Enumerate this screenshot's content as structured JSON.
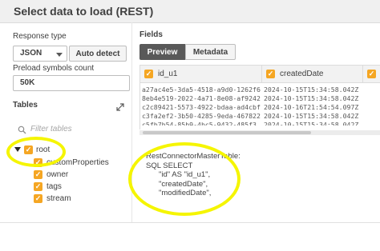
{
  "dialog": {
    "title": "Select data to load (REST)"
  },
  "left": {
    "response_type_label": "Response type",
    "response_type_value": "JSON",
    "auto_detect_label": "Auto detect",
    "preload_label": "Preload symbols count",
    "preload_value": "50K",
    "tables_label": "Tables",
    "filter_placeholder": "Filter tables",
    "tree": {
      "root_label": "root",
      "children": [
        "customProperties",
        "owner",
        "tags",
        "stream"
      ]
    }
  },
  "right": {
    "fields_label": "Fields",
    "tabs": [
      "Preview",
      "Metadata"
    ],
    "columns": [
      "id_u1",
      "createdDate"
    ],
    "rows": [
      [
        "a27ac4e5-3da5-4518-a9d0-1262f6",
        "2024-10-15T15:34:58.042Z"
      ],
      [
        "8eb4e519-2022-4a71-8e08-af9242",
        "2024-10-15T15:34:58.042Z"
      ],
      [
        "c2c89421-5573-4922-bdaa-ad4cbf",
        "2024-10-16T21:54:54.097Z"
      ],
      [
        "c3fa2ef2-3b50-4285-9eda-467822",
        "2024-10-15T15:34:58.042Z"
      ],
      [
        "c5fb7b54-85b9-4bc5-9432-485f3",
        "2024-10-15T15:34:58.042Z"
      ]
    ],
    "script": [
      "RestConnectorMasterTable:",
      "SQL SELECT",
      "\"id\" AS \"id_u1\",",
      "\"createdDate\",",
      "\"modifiedDate\","
    ]
  },
  "colors": {
    "highlight": "#f5f500",
    "accent": "#f5a623",
    "tab_active": "#595959"
  }
}
